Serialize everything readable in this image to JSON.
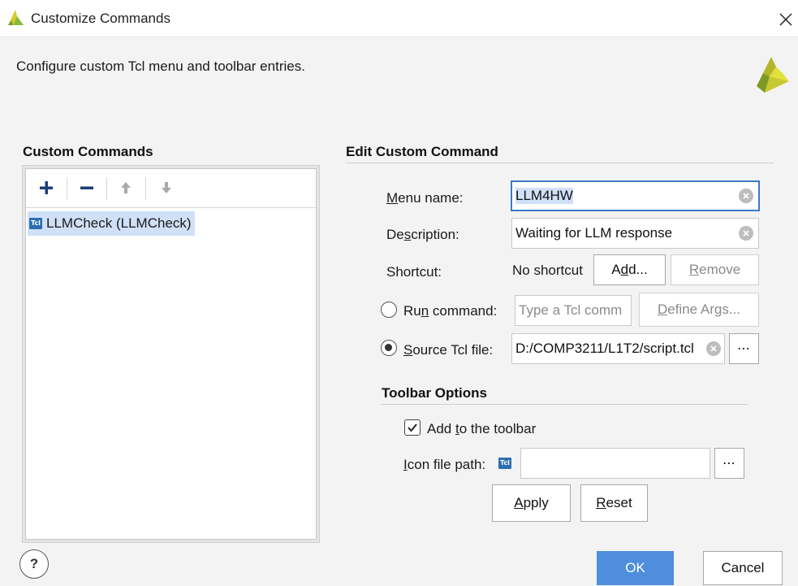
{
  "window": {
    "title": "Customize Commands"
  },
  "header": {
    "description": "Configure custom Tcl menu and toolbar entries."
  },
  "custom_commands": {
    "heading": "Custom Commands",
    "badge": "Tcl",
    "items": [
      {
        "label": "LLMCheck (LLMCheck)"
      }
    ]
  },
  "edit": {
    "heading": "Edit Custom Command",
    "menu_name_label": "Menu name:",
    "menu_name_value": "LLM4HW",
    "description_label": "Description:",
    "description_value": "Waiting for LLM response",
    "shortcut_label": "Shortcut:",
    "shortcut_value": "No shortcut",
    "add_label": "Add...",
    "remove_label": "Remove",
    "run_command_label": "Run command:",
    "run_command_placeholder": "Type a Tcl comm",
    "define_args_label": "Define Args...",
    "source_tcl_label": "Source Tcl file:",
    "source_tcl_value": "D:/COMP3211/L1T2/script.tcl",
    "browse_label": "⋯",
    "selected_mode": "source_tcl"
  },
  "toolbar_options": {
    "heading": "Toolbar Options",
    "add_to_toolbar_label": "Add to the toolbar",
    "add_to_toolbar_checked": true,
    "icon_path_label": "Icon file path:",
    "icon_badge": "Tcl",
    "icon_path_value": "",
    "browse_label": "⋯",
    "apply_label": "Apply",
    "reset_label": "Reset"
  },
  "footer": {
    "help_label": "?",
    "ok_label": "OK",
    "cancel_label": "Cancel"
  },
  "colors": {
    "accent": "#4f8edc",
    "selection": "#cfe0f7",
    "logo": "#c8c832"
  }
}
